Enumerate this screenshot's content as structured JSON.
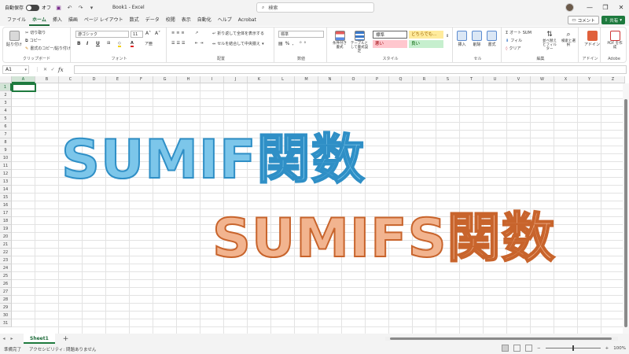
{
  "titlebar": {
    "autosave_label": "自動保存",
    "autosave_state": "オフ",
    "title": "Book1 - Excel",
    "search_placeholder": "検索"
  },
  "menu": {
    "tabs": [
      "ファイル",
      "ホーム",
      "挿入",
      "描画",
      "ページ レイアウト",
      "数式",
      "データ",
      "校閲",
      "表示",
      "自動化",
      "ヘルプ",
      "Acrobat"
    ],
    "active_tab": "ホーム",
    "comment_label": "コメント",
    "share_label": "共有"
  },
  "ribbon": {
    "clipboard": {
      "label": "クリップボード",
      "paste": "貼り付け",
      "cut": "切り取り",
      "copy": "コピー",
      "format_painter": "書式のコピー/貼り付け"
    },
    "font": {
      "label": "フォント",
      "name": "游ゴシック",
      "size": "11",
      "bold": "B",
      "italic": "I",
      "underline": "U"
    },
    "alignment": {
      "label": "配置",
      "wrap": "折り返して全体を表示する",
      "merge": "セルを結合して中央揃え"
    },
    "number": {
      "label": "数値",
      "format": "標準"
    },
    "styles": {
      "label": "スタイル",
      "conditional": "条件付き書式",
      "table": "テーブルとして書式設定",
      "standard": "標準",
      "neutral": "どちらでも...",
      "bad": "悪い",
      "good": "良い"
    },
    "cells": {
      "label": "セル",
      "insert": "挿入",
      "delete": "削除",
      "format": "書式"
    },
    "editing": {
      "label": "編集",
      "autosum": "オート SUM",
      "fill": "フィル",
      "clear": "クリア",
      "sort": "並べ替えとフィルター",
      "find": "検索と選択"
    },
    "addins": {
      "label": "アドイン",
      "addins_btn": "アドイン"
    },
    "adobe": {
      "label": "Adobe",
      "pdf": "PDF を作成"
    }
  },
  "formula_bar": {
    "name_box": "A1",
    "fx": "fx",
    "value": ""
  },
  "grid": {
    "columns": [
      "A",
      "B",
      "C",
      "D",
      "E",
      "F",
      "G",
      "H",
      "I",
      "J",
      "K",
      "L",
      "M",
      "N",
      "O",
      "P",
      "Q",
      "R",
      "S",
      "T",
      "U",
      "V",
      "W",
      "X",
      "Y",
      "Z"
    ],
    "rows": [
      "1",
      "2",
      "3",
      "4",
      "5",
      "6",
      "7",
      "8",
      "9",
      "10",
      "11",
      "12",
      "13",
      "14",
      "15",
      "16",
      "17",
      "18",
      "19",
      "20",
      "21",
      "22",
      "23",
      "24",
      "25",
      "26",
      "27",
      "28",
      "29",
      "30",
      "31"
    ],
    "active_cell": "A1"
  },
  "overlay": {
    "title1": "SUMIF関数",
    "title2": "SUMIFS関数",
    "title1_color": "#2f8fc6",
    "title2_color": "#c8642c"
  },
  "sheets": {
    "tabs": [
      "Sheet1"
    ],
    "add": "+"
  },
  "status": {
    "ready": "準備完了",
    "accessibility": "アクセシビリティ: 問題ありません",
    "zoom": "100%"
  },
  "colors": {
    "accent": "#1e7a3e"
  }
}
